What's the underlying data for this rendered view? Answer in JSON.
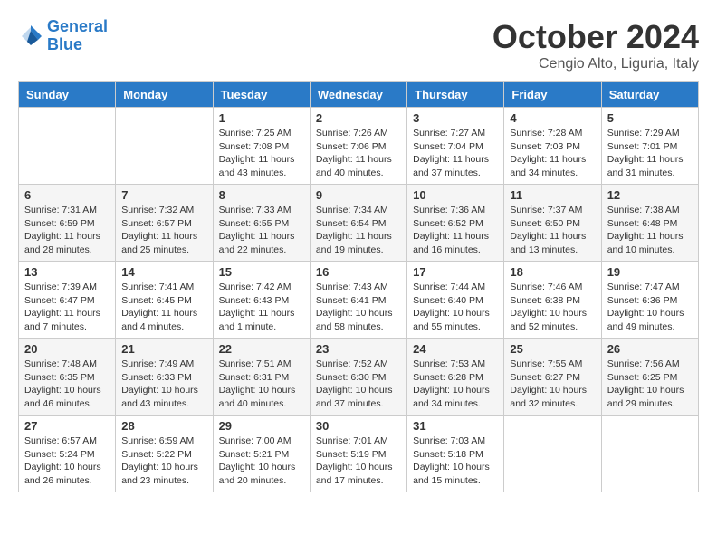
{
  "header": {
    "logo_line1": "General",
    "logo_line2": "Blue",
    "month": "October 2024",
    "location": "Cengio Alto, Liguria, Italy"
  },
  "days_of_week": [
    "Sunday",
    "Monday",
    "Tuesday",
    "Wednesday",
    "Thursday",
    "Friday",
    "Saturday"
  ],
  "weeks": [
    [
      null,
      null,
      {
        "day": "1",
        "sunrise": "7:25 AM",
        "sunset": "7:08 PM",
        "daylight": "11 hours and 43 minutes."
      },
      {
        "day": "2",
        "sunrise": "7:26 AM",
        "sunset": "7:06 PM",
        "daylight": "11 hours and 40 minutes."
      },
      {
        "day": "3",
        "sunrise": "7:27 AM",
        "sunset": "7:04 PM",
        "daylight": "11 hours and 37 minutes."
      },
      {
        "day": "4",
        "sunrise": "7:28 AM",
        "sunset": "7:03 PM",
        "daylight": "11 hours and 34 minutes."
      },
      {
        "day": "5",
        "sunrise": "7:29 AM",
        "sunset": "7:01 PM",
        "daylight": "11 hours and 31 minutes."
      }
    ],
    [
      {
        "day": "6",
        "sunrise": "7:31 AM",
        "sunset": "6:59 PM",
        "daylight": "11 hours and 28 minutes."
      },
      {
        "day": "7",
        "sunrise": "7:32 AM",
        "sunset": "6:57 PM",
        "daylight": "11 hours and 25 minutes."
      },
      {
        "day": "8",
        "sunrise": "7:33 AM",
        "sunset": "6:55 PM",
        "daylight": "11 hours and 22 minutes."
      },
      {
        "day": "9",
        "sunrise": "7:34 AM",
        "sunset": "6:54 PM",
        "daylight": "11 hours and 19 minutes."
      },
      {
        "day": "10",
        "sunrise": "7:36 AM",
        "sunset": "6:52 PM",
        "daylight": "11 hours and 16 minutes."
      },
      {
        "day": "11",
        "sunrise": "7:37 AM",
        "sunset": "6:50 PM",
        "daylight": "11 hours and 13 minutes."
      },
      {
        "day": "12",
        "sunrise": "7:38 AM",
        "sunset": "6:48 PM",
        "daylight": "11 hours and 10 minutes."
      }
    ],
    [
      {
        "day": "13",
        "sunrise": "7:39 AM",
        "sunset": "6:47 PM",
        "daylight": "11 hours and 7 minutes."
      },
      {
        "day": "14",
        "sunrise": "7:41 AM",
        "sunset": "6:45 PM",
        "daylight": "11 hours and 4 minutes."
      },
      {
        "day": "15",
        "sunrise": "7:42 AM",
        "sunset": "6:43 PM",
        "daylight": "11 hours and 1 minute."
      },
      {
        "day": "16",
        "sunrise": "7:43 AM",
        "sunset": "6:41 PM",
        "daylight": "10 hours and 58 minutes."
      },
      {
        "day": "17",
        "sunrise": "7:44 AM",
        "sunset": "6:40 PM",
        "daylight": "10 hours and 55 minutes."
      },
      {
        "day": "18",
        "sunrise": "7:46 AM",
        "sunset": "6:38 PM",
        "daylight": "10 hours and 52 minutes."
      },
      {
        "day": "19",
        "sunrise": "7:47 AM",
        "sunset": "6:36 PM",
        "daylight": "10 hours and 49 minutes."
      }
    ],
    [
      {
        "day": "20",
        "sunrise": "7:48 AM",
        "sunset": "6:35 PM",
        "daylight": "10 hours and 46 minutes."
      },
      {
        "day": "21",
        "sunrise": "7:49 AM",
        "sunset": "6:33 PM",
        "daylight": "10 hours and 43 minutes."
      },
      {
        "day": "22",
        "sunrise": "7:51 AM",
        "sunset": "6:31 PM",
        "daylight": "10 hours and 40 minutes."
      },
      {
        "day": "23",
        "sunrise": "7:52 AM",
        "sunset": "6:30 PM",
        "daylight": "10 hours and 37 minutes."
      },
      {
        "day": "24",
        "sunrise": "7:53 AM",
        "sunset": "6:28 PM",
        "daylight": "10 hours and 34 minutes."
      },
      {
        "day": "25",
        "sunrise": "7:55 AM",
        "sunset": "6:27 PM",
        "daylight": "10 hours and 32 minutes."
      },
      {
        "day": "26",
        "sunrise": "7:56 AM",
        "sunset": "6:25 PM",
        "daylight": "10 hours and 29 minutes."
      }
    ],
    [
      {
        "day": "27",
        "sunrise": "6:57 AM",
        "sunset": "5:24 PM",
        "daylight": "10 hours and 26 minutes."
      },
      {
        "day": "28",
        "sunrise": "6:59 AM",
        "sunset": "5:22 PM",
        "daylight": "10 hours and 23 minutes."
      },
      {
        "day": "29",
        "sunrise": "7:00 AM",
        "sunset": "5:21 PM",
        "daylight": "10 hours and 20 minutes."
      },
      {
        "day": "30",
        "sunrise": "7:01 AM",
        "sunset": "5:19 PM",
        "daylight": "10 hours and 17 minutes."
      },
      {
        "day": "31",
        "sunrise": "7:03 AM",
        "sunset": "5:18 PM",
        "daylight": "10 hours and 15 minutes."
      },
      null,
      null
    ]
  ]
}
